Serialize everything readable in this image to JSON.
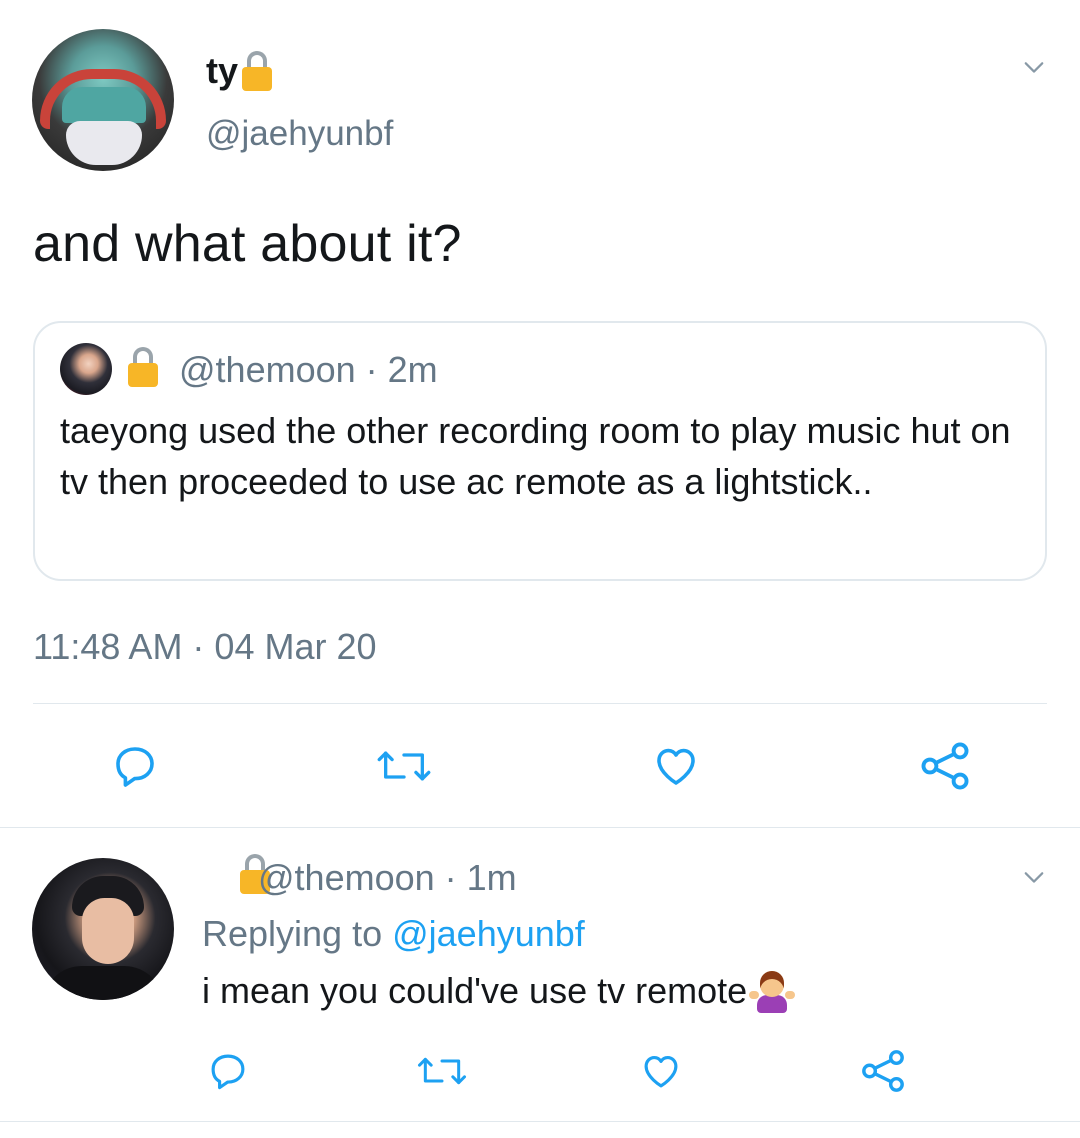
{
  "tweet": {
    "display_name": "ty",
    "handle": "@jaehyunbf",
    "text": "and what about it?",
    "timestamp": "11:48 AM · 04 Mar 20",
    "quoted": {
      "meta": "@themoon · 2m",
      "text": "taeyong used the other recording room to play music hut on tv then proceeded to use ac remote as a lightstick.."
    }
  },
  "reply": {
    "meta": "@themoon · 1m",
    "replying_prefix": "Replying to ",
    "replying_mention": "@jaehyunbf",
    "text": "i mean you could've use tv remote"
  },
  "colors": {
    "text_primary": "#14171a",
    "text_secondary": "#657786",
    "link": "#1da1f2",
    "divider": "#e1e8ed",
    "icon": "#1da1f2"
  },
  "icons": [
    "lock-icon",
    "chevron-down-icon",
    "reply-icon",
    "retweet-icon",
    "like-icon",
    "share-icon",
    "shrug-emoji-icon"
  ]
}
